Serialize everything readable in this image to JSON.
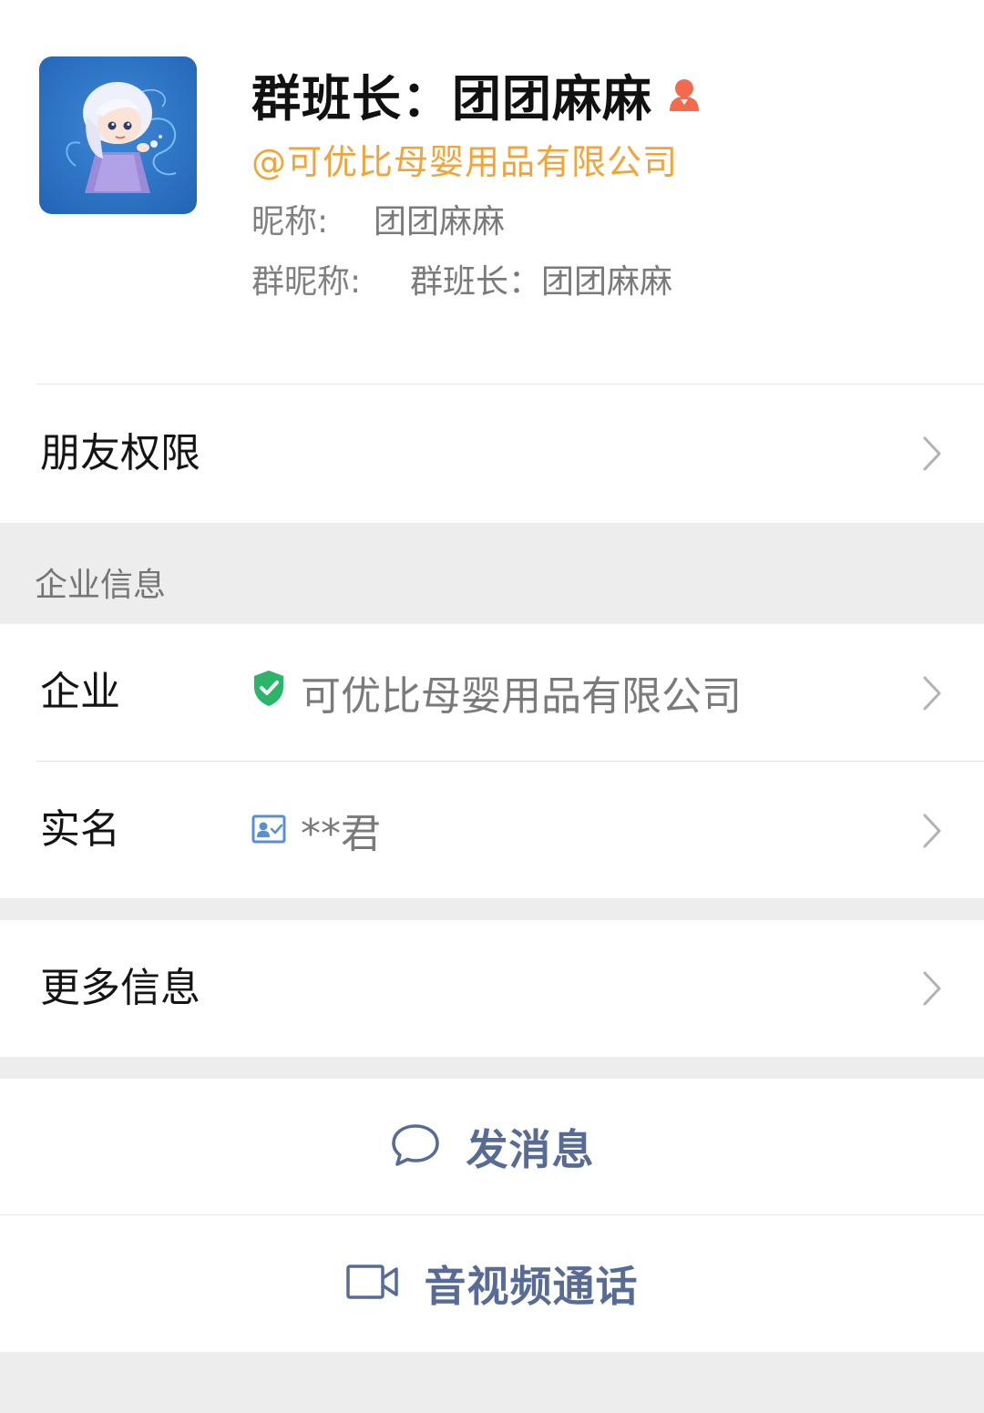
{
  "profile": {
    "display_name": "群班长：团团麻麻",
    "company_tag": "@可优比母婴用品有限公司",
    "nickname_label": "昵称:",
    "nickname_value": "团团麻麻",
    "group_nickname_label": "群昵称:",
    "group_nickname_value": "群班长：团团麻麻",
    "badge_icon": "person-badge-icon",
    "badge_color": "#f26b4f"
  },
  "friend_permission": {
    "label": "朋友权限"
  },
  "enterprise_section": {
    "title": "企业信息",
    "company_label": "企业",
    "company_value": "可优比母婴用品有限公司",
    "company_icon": "verified-shield-icon",
    "verified_color": "#2cb46a",
    "realname_label": "实名",
    "realname_value": "**君",
    "realname_icon": "id-card-icon"
  },
  "more_info": {
    "label": "更多信息"
  },
  "actions": {
    "message_label": "发消息",
    "message_icon": "chat-bubble-icon",
    "call_label": "音视频通话",
    "call_icon": "video-camera-icon",
    "link_color": "#576b95"
  }
}
